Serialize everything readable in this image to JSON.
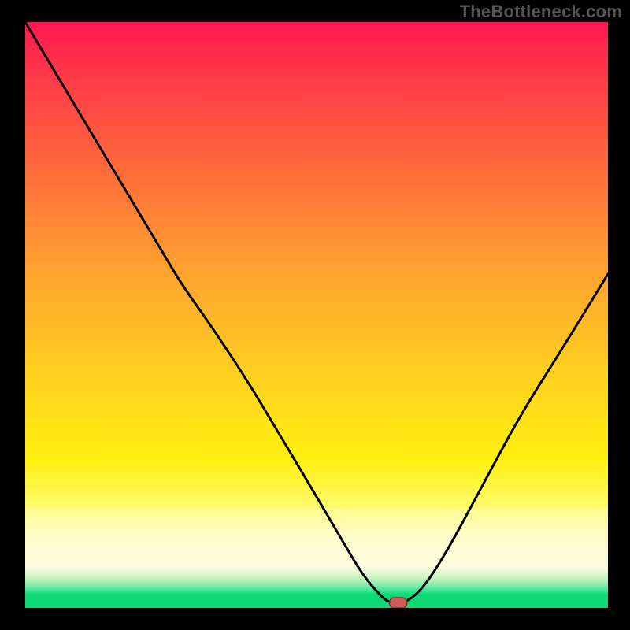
{
  "watermark": "TheBottleneck.com",
  "colors": {
    "frame": "#000000",
    "curve": "#000000",
    "marker_fill": "#d15a5a",
    "marker_stroke": "#8a2f2f",
    "green": "#0cd973"
  },
  "chart_data": {
    "type": "line",
    "title": "",
    "xlabel": "",
    "ylabel": "",
    "xlim": [
      0,
      100
    ],
    "ylim": [
      0,
      100
    ],
    "x": [
      0,
      6,
      12,
      18,
      24,
      27,
      32,
      38,
      44,
      50,
      55,
      58,
      61.5,
      63,
      65,
      68,
      72,
      78,
      85,
      92,
      100
    ],
    "values": [
      100,
      90,
      80,
      70,
      60,
      55,
      48,
      39,
      29,
      19,
      10.5,
      5.5,
      1.5,
      0.8,
      0.8,
      3,
      9,
      20,
      33,
      44,
      57
    ],
    "marker": {
      "x": 64,
      "y": 0.8
    },
    "note": "Values are approximate, read from pixel positions; y is bottleneck percentage where 0 = bottom (green) and 100 = top (red)."
  }
}
